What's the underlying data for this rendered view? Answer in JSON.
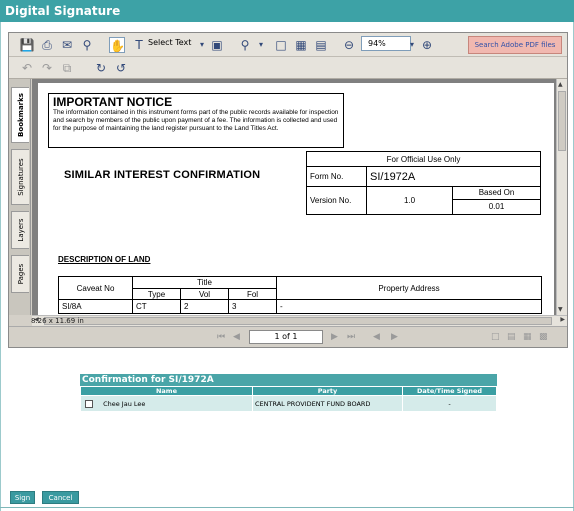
{
  "window": {
    "title": "Digital Signature"
  },
  "toolbar": {
    "select_text_label": "Select Text",
    "zoom_value": "94%",
    "search_label": "Search Adobe PDF files"
  },
  "side_tabs": [
    "Bookmarks",
    "Signatures",
    "Layers",
    "Pages"
  ],
  "document": {
    "notice": {
      "heading": "IMPORTANT NOTICE",
      "text": "The information contained in this instrument forms part of the public records available for inspection and search by members of the public upon payment of a fee. The information is collected and used for the purpose of maintaining the land register pursuant to the Land Titles Act."
    },
    "heading": "SIMILAR INTEREST CONFIRMATION",
    "official": {
      "header": "For Official Use Only",
      "form_no_label": "Form No.",
      "form_no_value": "SI/1972A",
      "version_label": "Version No.",
      "version_value": "1.0",
      "based_on_label": "Based On",
      "based_on_value": "0.01"
    },
    "land_heading": "DESCRIPTION OF LAND",
    "land_table": {
      "caveat_header": "Caveat No",
      "title_header": "Title",
      "type_header": "Type",
      "vol_header": "Vol",
      "fol_header": "Fol",
      "address_header": "Property Address",
      "row": {
        "caveat": "SI/8A",
        "type": "CT",
        "vol": "2",
        "fol": "3",
        "address": "-"
      }
    }
  },
  "status": {
    "page_size": "8.26 x 11.69 in",
    "page_indicator": "1 of 1"
  },
  "confirmation": {
    "title": "Confirmation for SI/1972A",
    "columns": [
      "Name",
      "Party",
      "Date/Time Signed"
    ],
    "rows": [
      {
        "name": "Chee Jau Lee",
        "party": "CENTRAL PROVIDENT FUND BOARD",
        "signed": "-"
      }
    ]
  },
  "buttons": {
    "sign": "Sign",
    "cancel": "Cancel"
  },
  "colors": {
    "accent": "#3da2a6",
    "search_button": "#f1b8b0"
  }
}
